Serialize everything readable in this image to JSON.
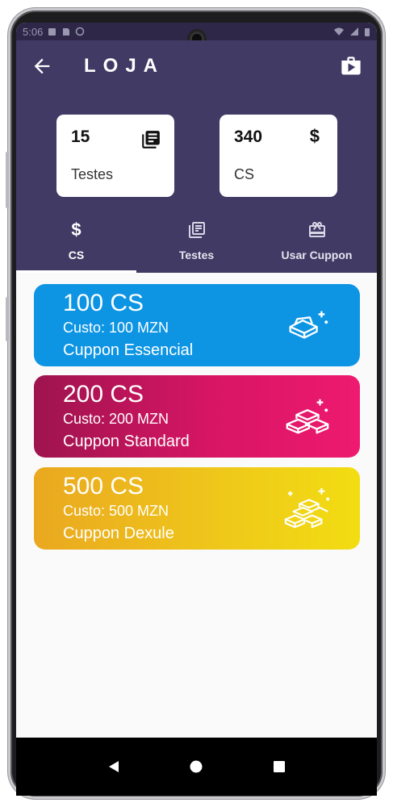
{
  "status_bar": {
    "time": "5:06"
  },
  "header": {
    "title": "LOJA"
  },
  "stats": [
    {
      "value": "15",
      "label": "Testes",
      "icon": "newspaper-icon"
    },
    {
      "value": "340",
      "label": "CS",
      "icon": "dollar-icon",
      "symbol": "$"
    }
  ],
  "tabs": [
    {
      "label": "CS",
      "icon": "dollar-icon",
      "symbol": "$",
      "active": true
    },
    {
      "label": "Testes",
      "icon": "newspaper-icon",
      "active": false
    },
    {
      "label": "Usar Cuppon",
      "icon": "gift-icon",
      "active": false
    }
  ],
  "coupons": [
    {
      "amount": "100 CS",
      "cost": "Custo: 100 MZN",
      "name": "Cuppon Essencial",
      "color": "#0d95e4",
      "icon": "gold-bar-icon"
    },
    {
      "amount": "200 CS",
      "cost": "Custo: 200 MZN",
      "name": "Cuppon Standard",
      "color": "#d81565",
      "icon": "gold-bars-icon"
    },
    {
      "amount": "500 CS",
      "cost": "Custo: 500 MZN",
      "name": "Cuppon Dexule",
      "color": "#efc91a",
      "icon": "gold-stack-icon"
    }
  ],
  "colors": {
    "header": "#403a64",
    "background": "#fafafa"
  }
}
